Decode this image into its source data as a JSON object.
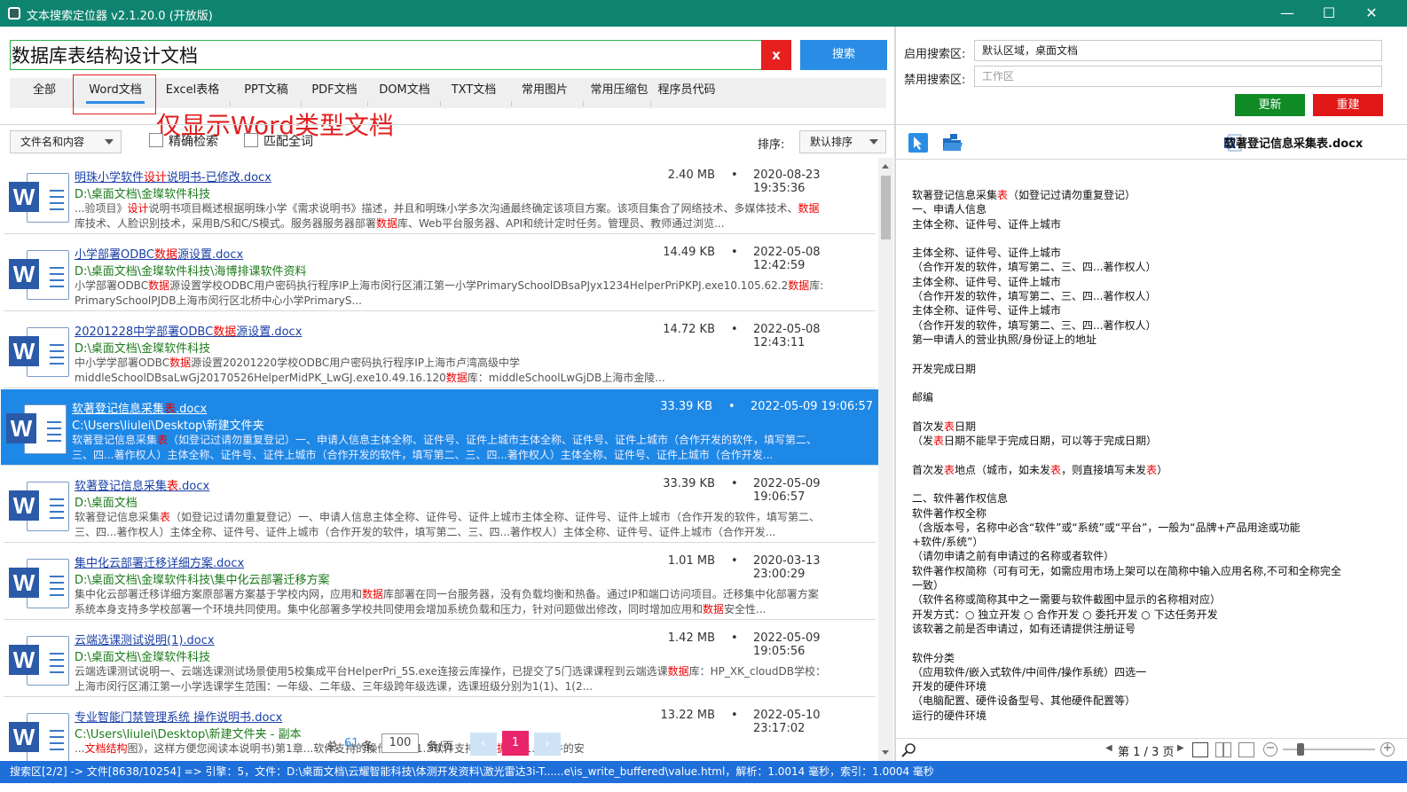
{
  "window": {
    "title": "文本搜索定位器 v2.1.20.0 (开放版)",
    "minimize": "—",
    "maximize": "☐",
    "close": "✕"
  },
  "search": {
    "value": "数据库表结构设计文档",
    "clear_label": "x",
    "button_label": "搜索"
  },
  "tabs": [
    "全部",
    "Word文档",
    "Excel表格",
    "PPT文稿",
    "PDF文档",
    "DOM文档",
    "TXT文档",
    "常用图片",
    "常用压缩包",
    "程序员代码"
  ],
  "selected_tab": "Word文档",
  "annotation": "仅显示Word类型文档",
  "filters": {
    "scope_select": "文件名和内容",
    "exact_label": "精确检索",
    "wholeword_label": "匹配全词",
    "sort_label": "排序:",
    "sort_select": "默认排序"
  },
  "results": [
    {
      "name_parts": [
        [
          "明珠小学软件",
          false
        ],
        [
          "设计",
          true
        ],
        [
          "说明书-已修改.docx",
          false
        ]
      ],
      "size": "2.40 MB",
      "date": "2020-08-23 19:35:36",
      "path": "D:\\桌面文档\\金璨软件科技",
      "snippet": [
        [
          [
            "...验项目》",
            false
          ],
          [
            "设计",
            true
          ],
          [
            "说明书项目概述根据明珠小学《需求说明书》描述，并且和明珠小学多次沟通最终确定该项目方案。该项目集合了网络技术、多媒体技术、",
            false
          ],
          [
            "数据",
            true
          ]
        ],
        [
          [
            "库技术、人脸识别技术，采用B/S和C/S模式。服务器服务器部署",
            false
          ],
          [
            "数据",
            true
          ],
          [
            "库、Web平台服务器、API和统计定时任务。管理员、教师通过浏览...",
            false
          ]
        ]
      ],
      "selected": false
    },
    {
      "name_parts": [
        [
          "小学部署ODBC",
          false
        ],
        [
          "数据",
          true
        ],
        [
          "源设置.docx",
          false
        ]
      ],
      "size": "14.49 KB",
      "date": "2022-05-08 12:42:59",
      "path": "D:\\桌面文档\\金璨软件科技\\海博排课软件资料",
      "snippet": [
        [
          [
            "小学部署ODBC",
            false
          ],
          [
            "数据",
            true
          ],
          [
            "源设置学校ODBC用户密码执行程序IP上海市闵行区浦江第一小学PrimarySchoolDBsaPJyx1234HelperPriPKPJ.exe10.105.62.2",
            false
          ],
          [
            "数据",
            true
          ],
          [
            "库:",
            false
          ]
        ],
        [
          [
            "PrimarySchoolPJDB上海市闵行区北桥中心小学PrimaryS...",
            false
          ]
        ]
      ],
      "selected": false
    },
    {
      "name_parts": [
        [
          "20201228中学部署ODBC",
          false
        ],
        [
          "数据",
          true
        ],
        [
          "源设置.docx",
          false
        ]
      ],
      "size": "14.72 KB",
      "date": "2022-05-08 12:43:11",
      "path": "D:\\桌面文档\\金璨软件科技",
      "snippet": [
        [
          [
            "中小学学部署ODBC",
            false
          ],
          [
            "数据",
            true
          ],
          [
            "源设置20201220学校ODBC用户密码执行程序IP上海市卢湾高级中学",
            false
          ]
        ],
        [
          [
            "middleSchoolDBsaLwGj20170526HelperMidPK_LwGJ.exe10.49.16.120",
            false
          ],
          [
            "数据",
            true
          ],
          [
            "库：middleSchoolLwGjDB上海市金陵...",
            false
          ]
        ]
      ],
      "selected": false
    },
    {
      "name_parts": [
        [
          "软著登记信息采集",
          false
        ],
        [
          "表",
          true
        ],
        [
          ".docx",
          false
        ]
      ],
      "size": "33.39 KB",
      "date": "2022-05-09 19:06:57",
      "path": "C:\\Users\\liulei\\Desktop\\新建文件夹",
      "snippet": [
        [
          [
            "软著登记信息采集",
            false
          ],
          [
            "表",
            true
          ],
          [
            "（如登记过请勿重复登记）一、申请人信息主体全称、证件号、证件上城市主体全称、证件号、证件上城市（合作开发的软件，填写第二、",
            false
          ]
        ],
        [
          [
            "三、四...著作权人）主体全称、证件号、证件上城市（合作开发的软件，填写第二、三、四...著作权人）主体全称、证件号、证件上城市（合作开发...",
            false
          ]
        ]
      ],
      "selected": true
    },
    {
      "name_parts": [
        [
          "软著登记信息采集",
          false
        ],
        [
          "表",
          true
        ],
        [
          ".docx",
          false
        ]
      ],
      "size": "33.39 KB",
      "date": "2022-05-09 19:06:57",
      "path": "D:\\桌面文档",
      "snippet": [
        [
          [
            "软著登记信息采集",
            false
          ],
          [
            "表",
            true
          ],
          [
            "（如登记过请勿重复登记）一、申请人信息主体全称、证件号、证件上城市主体全称、证件号、证件上城市（合作开发的软件，填写第二、",
            false
          ]
        ],
        [
          [
            "三、四...著作权人）主体全称、证件号、证件上城市（合作开发的软件，填写第二、三、四...著作权人）主体全称、证件号、证件上城市（合作开发...",
            false
          ]
        ]
      ],
      "selected": false
    },
    {
      "name_parts": [
        [
          "集中化云部署迁移详细方案.docx",
          false
        ]
      ],
      "size": "1.01 MB",
      "date": "2020-03-13 23:00:29",
      "path": "D:\\桌面文档\\金璨软件科技\\集中化云部署迁移方案",
      "snippet": [
        [
          [
            "集中化云部署迁移详细方案原部署方案基于学校内网，应用和",
            false
          ],
          [
            "数据",
            true
          ],
          [
            "库部署在同一台服务器，没有负载均衡和热备。通过IP和端口访问项目。迁移集中化部署方案",
            false
          ]
        ],
        [
          [
            "系统本身支持多学校部署一个环境共同使用。集中化部署多学校共同使用会增加系统负载和压力，针对问题做出修改，同时增加应用和",
            false
          ],
          [
            "数据",
            true
          ],
          [
            "安全性...",
            false
          ]
        ]
      ],
      "selected": false
    },
    {
      "name_parts": [
        [
          "云端选课测试说明(1).docx",
          false
        ]
      ],
      "size": "1.42 MB",
      "date": "2022-05-09 19:05:56",
      "path": "D:\\桌面文档\\金璨软件科技",
      "snippet": [
        [
          [
            "云端选课测试说明一、云端选课测试场景使用5校集成平台HelperPri_5S.exe连接云库操作，已提交了5门选课课程到云端选课",
            false
          ],
          [
            "数据",
            true
          ],
          [
            "库：HP_XK_cloudDB学校：",
            false
          ]
        ],
        [
          [
            "上海市闵行区浦江第一小学选课学生范围：一年级、二年级、三年级跨年级选课，选课班级分别为1(1)、1(2...",
            false
          ]
        ]
      ],
      "selected": false
    },
    {
      "name_parts": [
        [
          "专业智能门禁管理系统 操作说明书.docx",
          false
        ]
      ],
      "size": "13.22 MB",
      "date": "2022-05-10 23:17:02",
      "path": "C:\\Users\\liulei\\Desktop\\新建文件夹 - 副本",
      "snippet": [
        [
          [
            "...",
            false
          ],
          [
            "文档结构",
            true
          ],
          [
            "图》，这样方便您阅读本说明书)第1章...软件支持的操作系统71.3软件支持的",
            false
          ],
          [
            "数据",
            true
          ],
          [
            "库71.4软件的安",
            false
          ]
        ],
        [
          [
            "",
            false
          ]
        ]
      ],
      "selected": false
    }
  ],
  "pager": {
    "total_prefix": "总",
    "total_count": "61",
    "total_suffix": "条",
    "page_size": "100",
    "per_page_label": "条/页",
    "current_page": "1"
  },
  "right": {
    "enable_label": "启用搜索区:",
    "enable_value": "默认区域，桌面文档",
    "disable_label": "禁用搜索区:",
    "disable_placeholder": "工作区",
    "update_label": "更新",
    "rebuild_label": "重建",
    "preview_title": "软著登记信息采集表.docx",
    "page_indicator": "第 1 / 3 页"
  },
  "preview_lines": [
    [
      [
        "软著登记信息采集",
        false
      ],
      [
        "表",
        true
      ],
      [
        "（如登记过请勿重复登记）",
        false
      ]
    ],
    [
      [
        "一、申请人信息",
        false
      ]
    ],
    [
      [
        "主体全称、证件号、证件上城市",
        false
      ]
    ],
    [
      [
        "",
        false
      ]
    ],
    [
      [
        "主体全称、证件号、证件上城市",
        false
      ]
    ],
    [
      [
        "（合作开发的软件，填写第二、三、四...著作权人）",
        false
      ]
    ],
    [
      [
        "主体全称、证件号、证件上城市",
        false
      ]
    ],
    [
      [
        "（合作开发的软件，填写第二、三、四...著作权人）",
        false
      ]
    ],
    [
      [
        "主体全称、证件号、证件上城市",
        false
      ]
    ],
    [
      [
        "（合作开发的软件，填写第二、三、四...著作权人）",
        false
      ]
    ],
    [
      [
        "第一申请人的营业执照/身份证上的地址",
        false
      ]
    ],
    [
      [
        "",
        false
      ]
    ],
    [
      [
        "开发完成日期",
        false
      ]
    ],
    [
      [
        "",
        false
      ]
    ],
    [
      [
        "邮编",
        false
      ]
    ],
    [
      [
        "",
        false
      ]
    ],
    [
      [
        "首次发",
        false
      ],
      [
        "表",
        true
      ],
      [
        "日期",
        false
      ]
    ],
    [
      [
        "（发",
        false
      ],
      [
        "表",
        true
      ],
      [
        "日期不能早于完成日期，可以等于完成日期）",
        false
      ]
    ],
    [
      [
        "",
        false
      ]
    ],
    [
      [
        "首次发",
        false
      ],
      [
        "表",
        true
      ],
      [
        "地点（城市，如未发",
        false
      ],
      [
        "表",
        true
      ],
      [
        "，则直接填写未发",
        false
      ],
      [
        "表",
        true
      ],
      [
        "）",
        false
      ]
    ],
    [
      [
        "",
        false
      ]
    ],
    [
      [
        "二、软件著作权信息",
        false
      ]
    ],
    [
      [
        "软件著作权全称",
        false
      ]
    ],
    [
      [
        "（含版本号，名称中必含“软件”或“系统”或“平台”，一般为“品牌+产品用途或功能",
        false
      ]
    ],
    [
      [
        "+软件/系统”）",
        false
      ]
    ],
    [
      [
        "（请勿申请之前有申请过的名称或者软件）",
        false
      ]
    ],
    [
      [
        "软件著作权简称（可有可无，如需应用市场上架可以在简称中输入应用名称,不可和全称完全",
        false
      ]
    ],
    [
      [
        "一致）",
        false
      ]
    ],
    [
      [
        "（软件名称或简称其中之一需要与软件截图中显示的名称相对应）",
        false
      ]
    ],
    [
      [
        "开发方式：○ 独立开发 ○ 合作开发 ○ 委托开发 ○ 下达任务开发",
        false
      ]
    ],
    [
      [
        "该软著之前是否申请过，如有还请提供注册证号",
        false
      ]
    ],
    [
      [
        "",
        false
      ]
    ],
    [
      [
        "软件分类",
        false
      ]
    ],
    [
      [
        "（应用软件/嵌入式软件/中间件/操作系统）四选一",
        false
      ]
    ],
    [
      [
        "开发的硬件环境",
        false
      ]
    ],
    [
      [
        "（电脑配置、硬件设备型号、其他硬件配置等）",
        false
      ]
    ],
    [
      [
        "运行的硬件环境",
        false
      ]
    ]
  ],
  "status": "搜索区[2/2] -> 文件[8638/10254] => 引擎：5，文件：D:\\桌面文档\\云耀智能科技\\体测开发资料\\激光雷达3i-T......e\\is_write_buffered\\value.html，解析：1.0014 毫秒，索引：1.0004 毫秒",
  "colors": {
    "titlebar": "#0e8470",
    "accent": "#2a8de5",
    "selected_row": "#1e88e6",
    "highlight": "#e00000",
    "statusbar": "#1e6fd9"
  }
}
